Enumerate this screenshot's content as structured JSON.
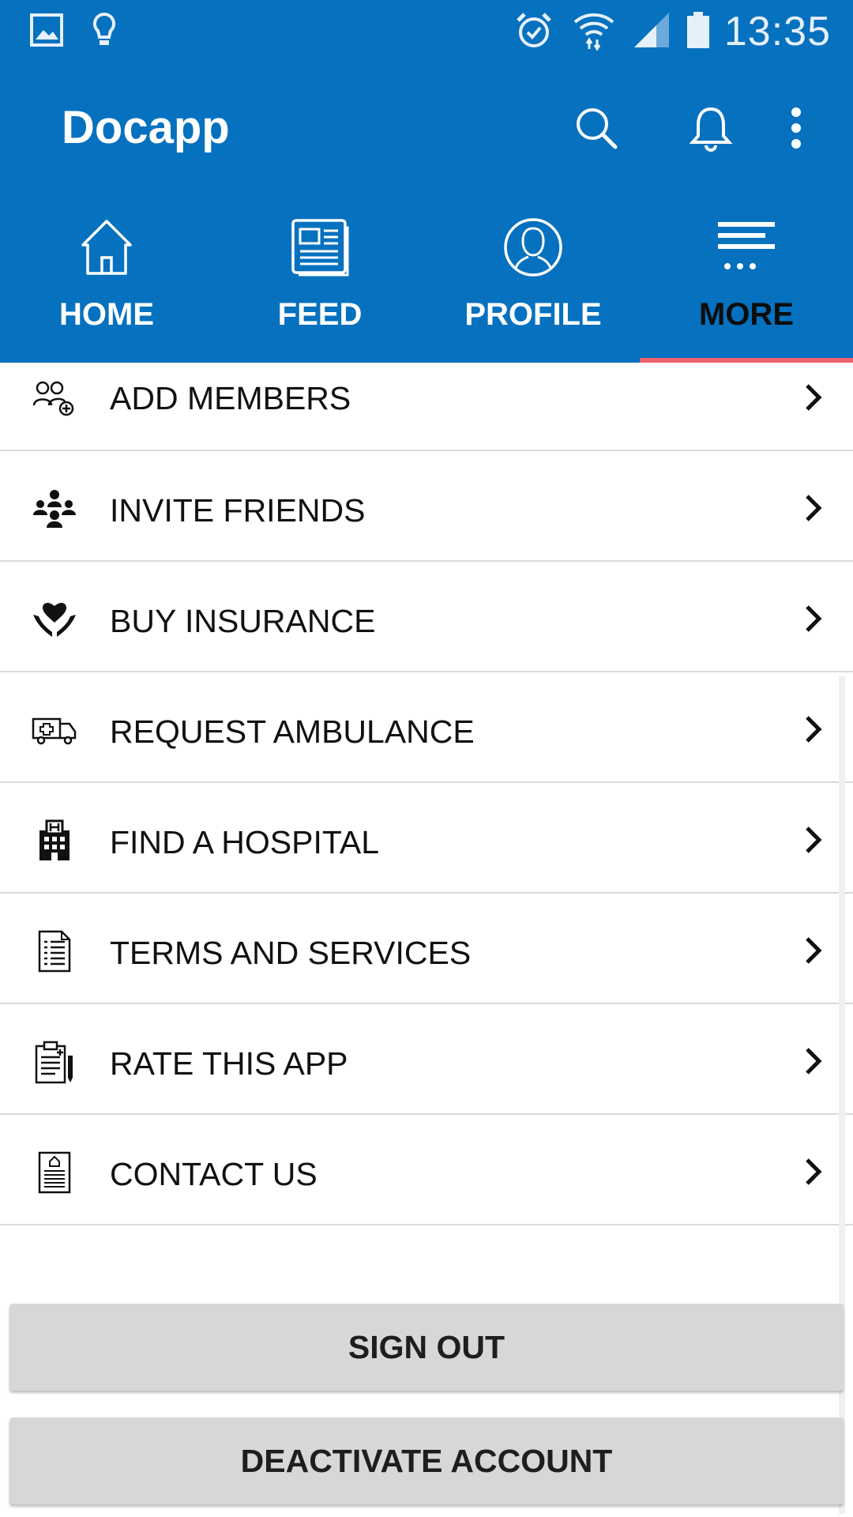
{
  "status_bar": {
    "time": "13:35",
    "icons": [
      "gallery-icon",
      "lightbulb-icon",
      "alarm-icon",
      "wifi-icon",
      "signal-icon",
      "battery-icon"
    ]
  },
  "toolbar": {
    "title": "Docapp",
    "actions": [
      "search-icon",
      "bell-icon",
      "overflow-menu-icon"
    ]
  },
  "tabs": [
    {
      "label": "HOME",
      "icon": "home-icon",
      "active": false
    },
    {
      "label": "FEED",
      "icon": "newspaper-icon",
      "active": false
    },
    {
      "label": "PROFILE",
      "icon": "user-icon",
      "active": false
    },
    {
      "label": "MORE",
      "icon": "more-menu-icon",
      "active": true
    }
  ],
  "menu": {
    "items": [
      {
        "label": "ADD MEMBERS",
        "icon": "add-members-icon"
      },
      {
        "label": "INVITE FRIENDS",
        "icon": "invite-friends-icon"
      },
      {
        "label": "BUY INSURANCE",
        "icon": "heart-hands-icon"
      },
      {
        "label": "REQUEST AMBULANCE",
        "icon": "ambulance-icon"
      },
      {
        "label": "FIND A HOSPITAL",
        "icon": "hospital-icon"
      },
      {
        "label": "TERMS AND SERVICES",
        "icon": "document-list-icon"
      },
      {
        "label": "RATE THIS APP",
        "icon": "clipboard-icon"
      },
      {
        "label": "CONTACT US",
        "icon": "contact-document-icon"
      }
    ]
  },
  "buttons": {
    "sign_out": "SIGN OUT",
    "deactivate": "DEACTIVATE ACCOUNT"
  },
  "colors": {
    "primary": "#0671bf",
    "tab_indicator": "#f0626b",
    "button_bg": "#d7d7d7"
  }
}
